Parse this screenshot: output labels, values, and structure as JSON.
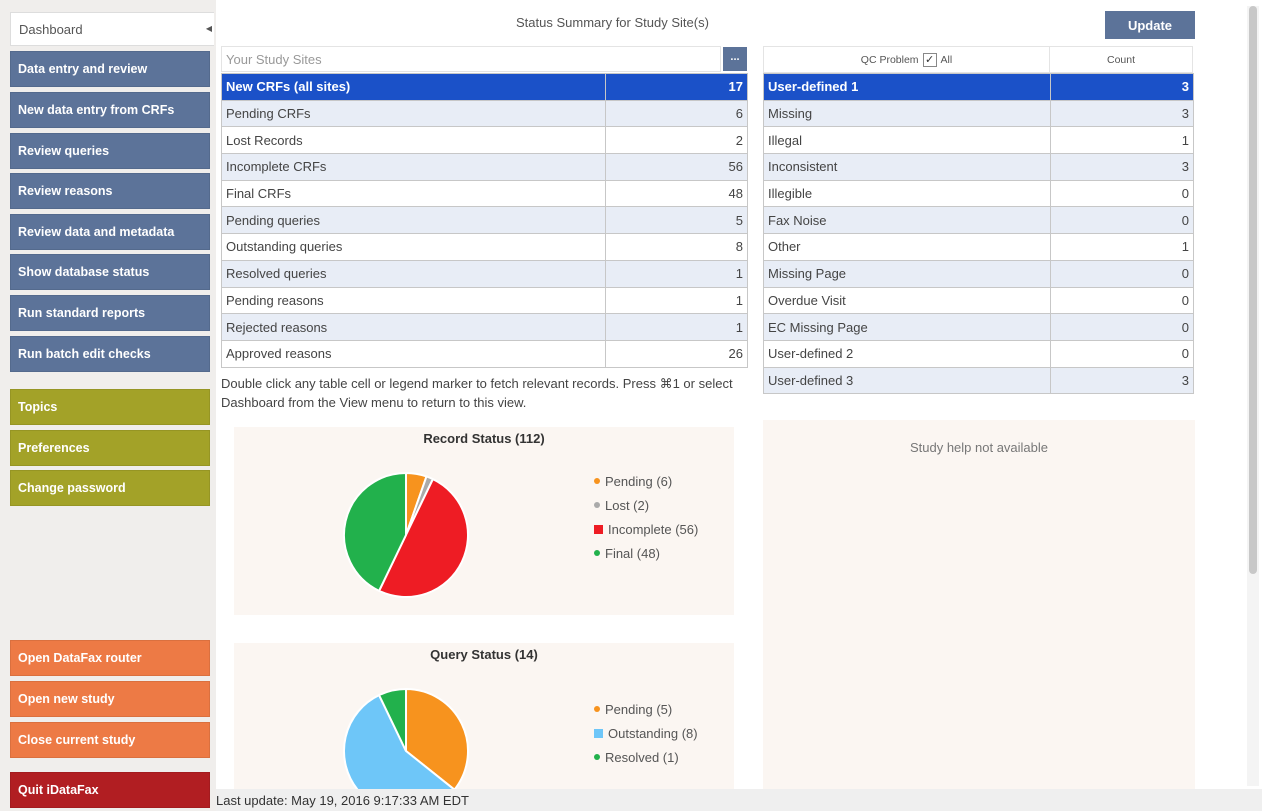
{
  "sidebar": {
    "dashboard_tab": "Dashboard",
    "primary_items": [
      {
        "label": "Data entry and review"
      },
      {
        "label": "New data entry from CRFs"
      },
      {
        "label": "Review  queries"
      },
      {
        "label": "Review reasons"
      },
      {
        "label": "Review data and metadata"
      },
      {
        "label": "Show database status"
      },
      {
        "label": "Run standard reports"
      },
      {
        "label": "Run batch edit checks"
      }
    ],
    "secondary_items": [
      {
        "label": "Topics"
      },
      {
        "label": "Preferences"
      },
      {
        "label": "Change password"
      }
    ],
    "study_items": [
      {
        "label": "Open DataFax router"
      },
      {
        "label": "Open new study"
      },
      {
        "label": "Close current study"
      }
    ],
    "quit_label": "Quit iDataFax"
  },
  "header": {
    "title": "Status Summary for Study Site(s)",
    "update_label": "Update"
  },
  "sites": {
    "placeholder": "Your Study Sites",
    "browse_label": "..."
  },
  "status_table": [
    {
      "label": "New CRFs (all sites)",
      "count": "17",
      "selected": true
    },
    {
      "label": "Pending CRFs",
      "count": "6"
    },
    {
      "label": "Lost Records",
      "count": "2"
    },
    {
      "label": "Incomplete CRFs",
      "count": "56"
    },
    {
      "label": "Final CRFs",
      "count": "48"
    },
    {
      "label": "Pending queries",
      "count": "5"
    },
    {
      "label": "Outstanding queries",
      "count": "8"
    },
    {
      "label": "Resolved queries",
      "count": "1"
    },
    {
      "label": "Pending reasons",
      "count": "1"
    },
    {
      "label": "Rejected reasons",
      "count": "1"
    },
    {
      "label": "Approved reasons",
      "count": "26"
    }
  ],
  "qc": {
    "problem_header": "QC Problem",
    "all_label": "All",
    "all_checked": true,
    "count_header": "Count",
    "rows": [
      {
        "label": "User-defined 1",
        "count": "3",
        "selected": true
      },
      {
        "label": "Missing",
        "count": "3"
      },
      {
        "label": "Illegal",
        "count": "1"
      },
      {
        "label": "Inconsistent",
        "count": "3"
      },
      {
        "label": "Illegible",
        "count": "0"
      },
      {
        "label": "Fax Noise",
        "count": "0"
      },
      {
        "label": "Other",
        "count": "1"
      },
      {
        "label": "Missing Page",
        "count": "0"
      },
      {
        "label": "Overdue Visit",
        "count": "0"
      },
      {
        "label": "EC Missing Page",
        "count": "0"
      },
      {
        "label": "User-defined 2",
        "count": "0"
      },
      {
        "label": "User-defined 3",
        "count": "3"
      }
    ]
  },
  "hint": "Double click any table cell or legend marker to fetch relevant records. Press ⌘1 or select Dashboard from the View menu to return to this view.",
  "help_text": "Study help not available",
  "status_bar": "Last update: May 19, 2016 9:17:33 AM EDT",
  "chart_data": [
    {
      "type": "pie",
      "title": "Record Status (112)",
      "slices": [
        {
          "label": "Pending (6)",
          "value": 6,
          "color": "#f7931e"
        },
        {
          "label": "Lost (2)",
          "value": 2,
          "color": "#aaaaaa"
        },
        {
          "label": "Incomplete (56)",
          "value": 56,
          "color": "#ee1c24"
        },
        {
          "label": "Final (48)",
          "value": 48,
          "color": "#22b14c"
        }
      ]
    },
    {
      "type": "pie",
      "title": "Query Status (14)",
      "slices": [
        {
          "label": "Pending (5)",
          "value": 5,
          "color": "#f7931e"
        },
        {
          "label": "Outstanding (8)",
          "value": 8,
          "color": "#6ec6f8"
        },
        {
          "label": "Resolved (1)",
          "value": 1,
          "color": "#22b14c"
        }
      ]
    }
  ],
  "colors": {
    "nav_blue": "#5c7399",
    "nav_olive": "#a3a228",
    "nav_orange": "#ed7a45",
    "nav_red": "#b11e22",
    "selection": "#1b51c8",
    "alt_row": "#e8edf6"
  }
}
